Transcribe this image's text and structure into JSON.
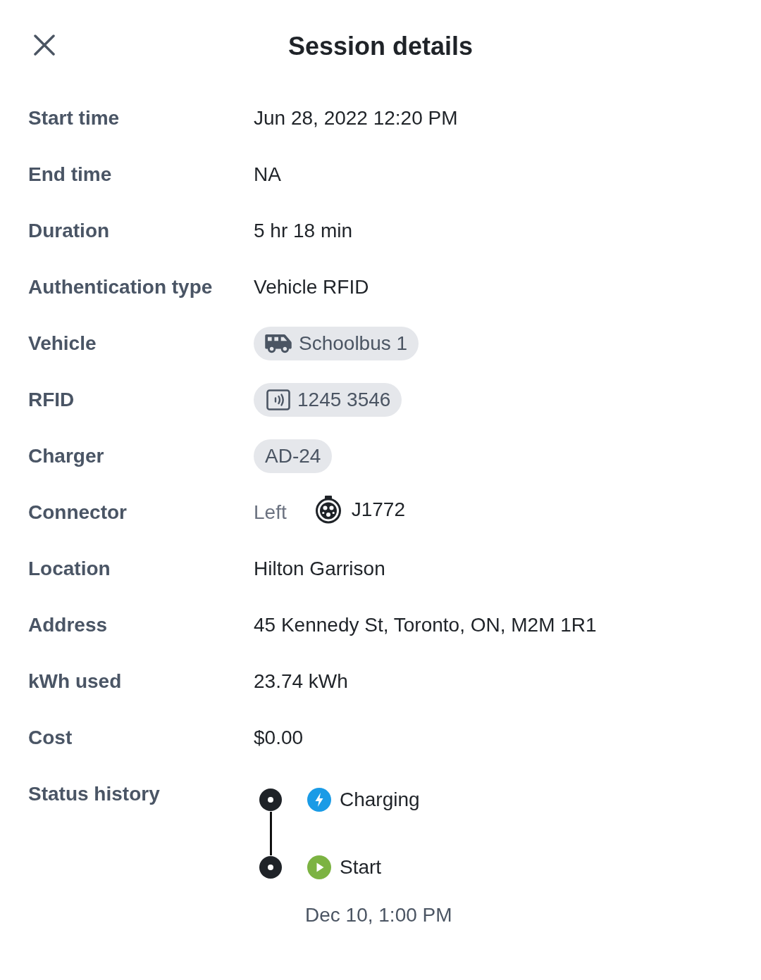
{
  "header": {
    "title": "Session details"
  },
  "details": [
    {
      "kind": "text",
      "label": "Start time",
      "value": "Jun 28, 2022 12:20 PM"
    },
    {
      "kind": "text",
      "label": "End time",
      "value": "NA"
    },
    {
      "kind": "text",
      "label": "Duration",
      "value": "5 hr 18 min"
    },
    {
      "kind": "text",
      "label": "Authentication type",
      "value": "Vehicle RFID"
    },
    {
      "kind": "vehicle",
      "label": "Vehicle",
      "value": "Schoolbus 1"
    },
    {
      "kind": "rfid",
      "label": "RFID",
      "value": "1245 3546"
    },
    {
      "kind": "tag",
      "label": "Charger",
      "value": "AD-24"
    },
    {
      "kind": "connector",
      "label": "Connector",
      "side": "Left",
      "value": "J1772"
    },
    {
      "kind": "text",
      "label": "Location",
      "value": "Hilton Garrison"
    },
    {
      "kind": "text",
      "label": "Address",
      "value": "45 Kennedy St, Toronto, ON, M2M 1R1"
    },
    {
      "kind": "text",
      "label": "kWh used",
      "value": "23.74 kWh"
    },
    {
      "kind": "text",
      "label": "Cost",
      "value": "$0.00"
    }
  ],
  "status_history": {
    "label": "Status history",
    "entries": [
      {
        "kind": "charging",
        "status": "Charging",
        "color": "#1a9be6"
      },
      {
        "kind": "start",
        "status": "Start",
        "color": "#7cb342",
        "time": "Dec 10, 1:00 PM"
      }
    ]
  }
}
